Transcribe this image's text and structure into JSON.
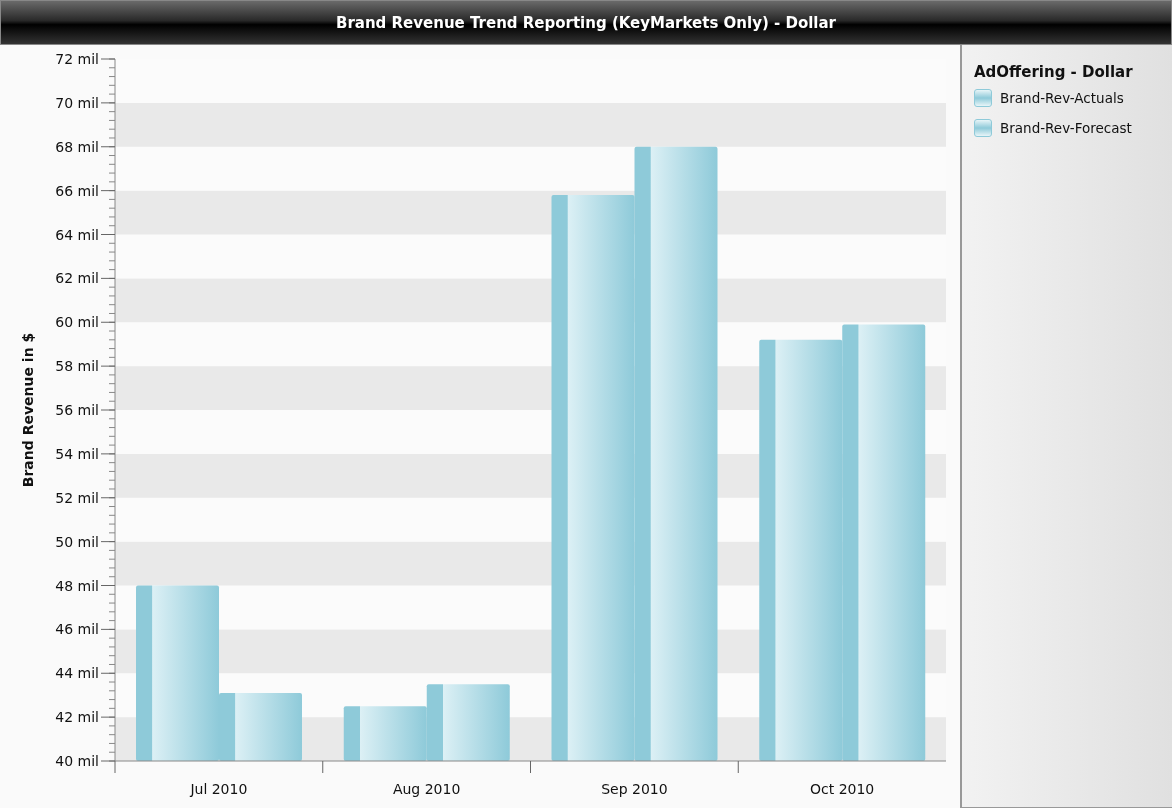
{
  "window": {
    "title": "Brand Revenue Trend Reporting (KeyMarkets Only) - Dollar"
  },
  "chart": {
    "chart_data": {
      "type": "bar",
      "ylabel": "Brand Revenue in $",
      "categories": [
        "Jul 2010",
        "Aug 2010",
        "Sep 2010",
        "Oct 2010"
      ],
      "series": [
        {
          "name": "Brand-Rev-Actuals",
          "color": "#8ecad9",
          "values": [
            48.0,
            42.5,
            65.8,
            59.2
          ]
        },
        {
          "name": "Brand-Rev-Forecast",
          "color": "#8ecad9",
          "values": [
            43.1,
            43.5,
            68.0,
            59.9
          ]
        }
      ],
      "ylim": [
        40,
        72
      ],
      "yticks": [
        {
          "value": 40,
          "label": "40 mil"
        },
        {
          "value": 42,
          "label": "42 mil"
        },
        {
          "value": 44,
          "label": "44 mil"
        },
        {
          "value": 46,
          "label": "46 mil"
        },
        {
          "value": 48,
          "label": "48 mil"
        },
        {
          "value": 50,
          "label": "50 mil"
        },
        {
          "value": 52,
          "label": "52 mil"
        },
        {
          "value": 54,
          "label": "54 mil"
        },
        {
          "value": 56,
          "label": "56 mil"
        },
        {
          "value": 58,
          "label": "58 mil"
        },
        {
          "value": 60,
          "label": "60 mil"
        },
        {
          "value": 62,
          "label": "62 mil"
        },
        {
          "value": 64,
          "label": "64 mil"
        },
        {
          "value": 66,
          "label": "66 mil"
        },
        {
          "value": 68,
          "label": "68 mil"
        },
        {
          "value": 70,
          "label": "70 mil"
        },
        {
          "value": 72,
          "label": "72 mil"
        }
      ]
    }
  },
  "legend": {
    "title": "AdOffering - Dollar"
  }
}
